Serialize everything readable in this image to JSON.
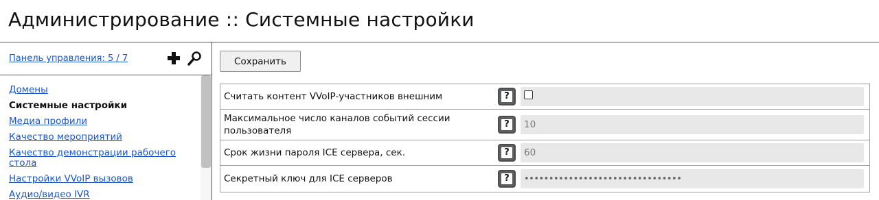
{
  "page": {
    "title": "Администрирование :: Системные настройки"
  },
  "sidebar": {
    "panel_link": "Панель управления: 5 / 7",
    "items": [
      {
        "label": "Домены"
      },
      {
        "label": "Системные настройки"
      },
      {
        "label": "Медиа профили"
      },
      {
        "label": "Качество мероприятий"
      },
      {
        "label": "Качество демонстрации рабочего стола"
      },
      {
        "label": "Настройки VVoIP вызовов"
      },
      {
        "label": "Аудио/видео IVR"
      }
    ],
    "active_index": 1
  },
  "toolbar": {
    "save_label": "Сохранить"
  },
  "settings": {
    "help_glyph": "?",
    "rows": [
      {
        "label": "Считать контент VVoIP-участников внешним",
        "type": "checkbox",
        "checked": false
      },
      {
        "label": "Максимальное число каналов событий сессии пользователя",
        "type": "number",
        "value": "10"
      },
      {
        "label": "Срок жизни пароля ICE сервера, сек.",
        "type": "number",
        "value": "60"
      },
      {
        "label": "Секретный ключ для ICE серверов",
        "type": "password",
        "value": "••••••••••••••••••••••••••••••••"
      }
    ]
  },
  "colors": {
    "link": "#1a56c8",
    "help_button": "#5d5f61",
    "field_background": "#e8e8e8"
  },
  "icons": {
    "add": "plus-icon",
    "search": "search-icon",
    "help": "help-icon"
  }
}
